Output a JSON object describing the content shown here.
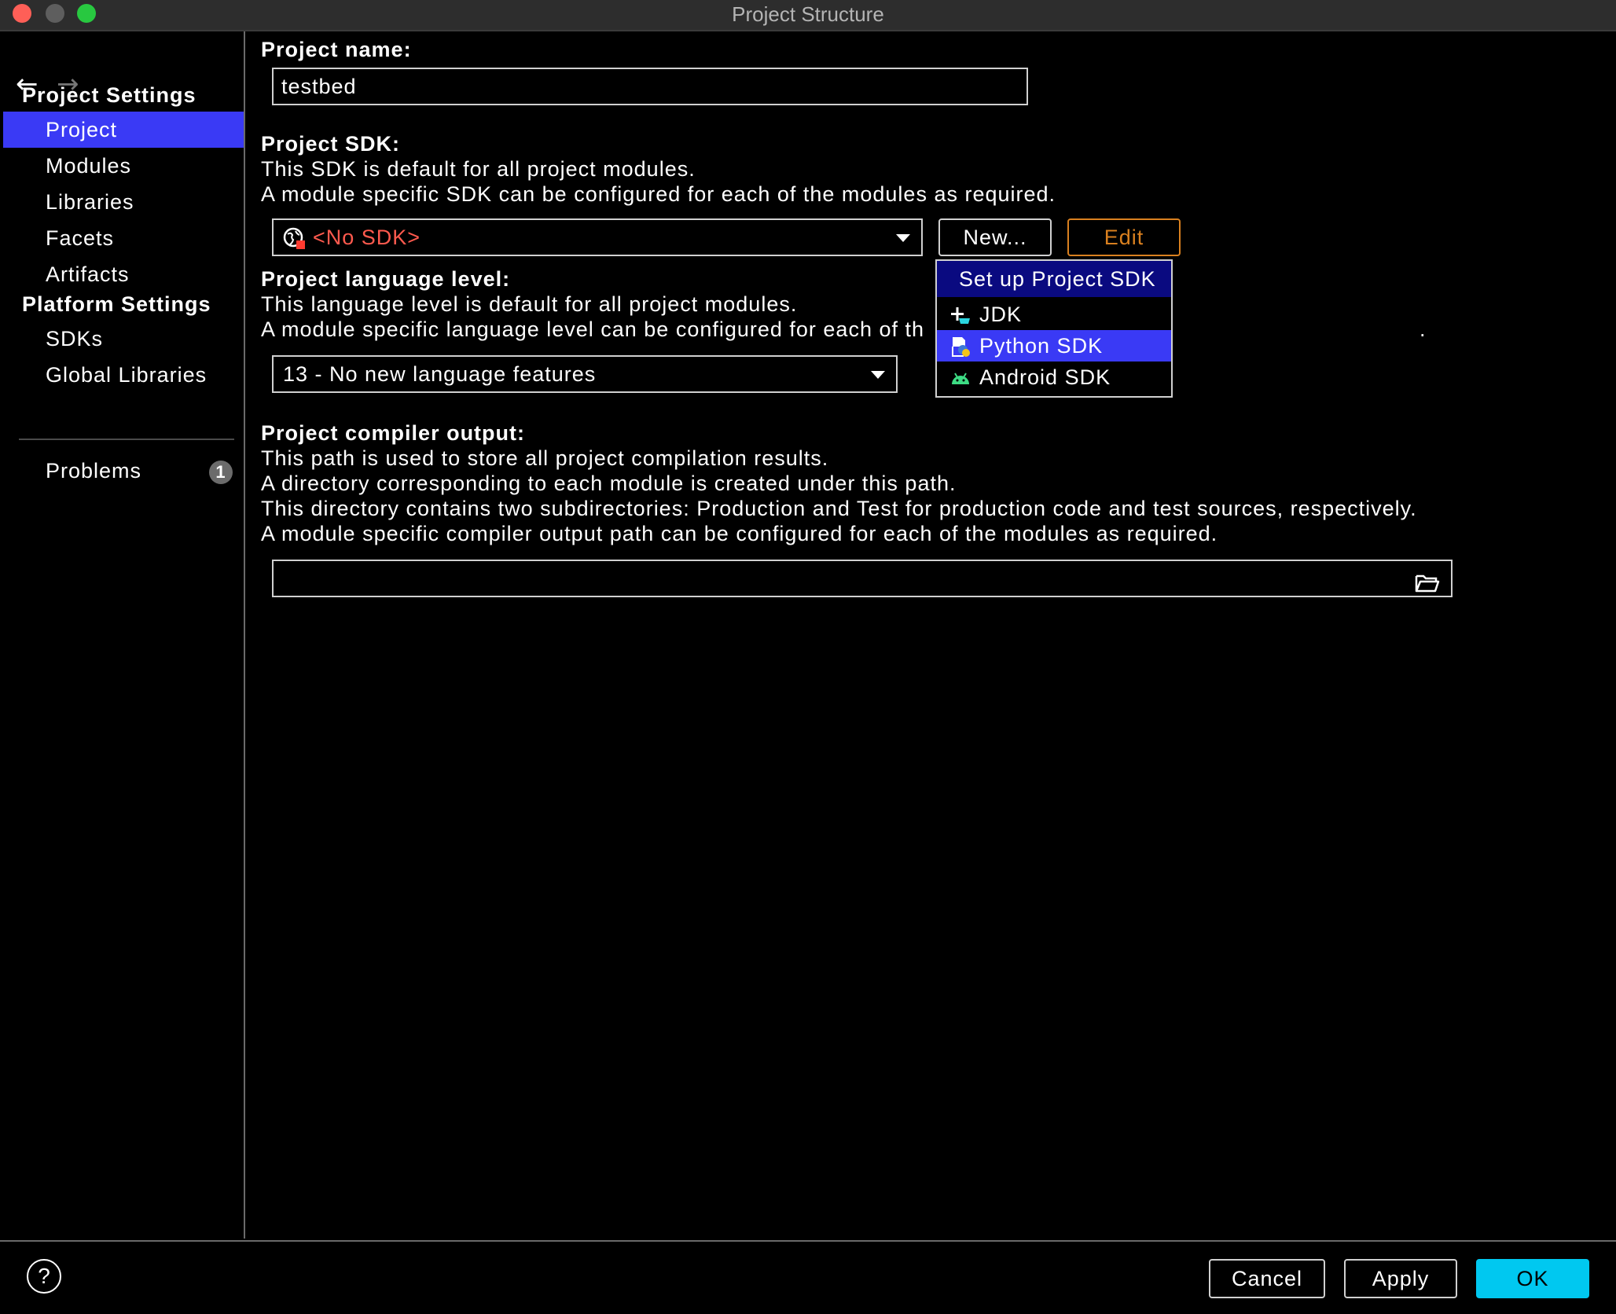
{
  "window": {
    "title": "Project Structure"
  },
  "nav": {
    "back_icon": "arrow-left-icon",
    "forward_icon": "arrow-right-icon"
  },
  "sidebar": {
    "project_settings_header": "Project Settings",
    "project_items": [
      {
        "label": "Project",
        "selected": true
      },
      {
        "label": "Modules",
        "selected": false
      },
      {
        "label": "Libraries",
        "selected": false
      },
      {
        "label": "Facets",
        "selected": false
      },
      {
        "label": "Artifacts",
        "selected": false
      }
    ],
    "platform_settings_header": "Platform Settings",
    "platform_items": [
      {
        "label": "SDKs"
      },
      {
        "label": "Global Libraries"
      }
    ],
    "problems": {
      "label": "Problems",
      "count": "1"
    }
  },
  "main": {
    "project_name": {
      "label": "Project name:",
      "value": "testbed"
    },
    "project_sdk": {
      "label": "Project SDK:",
      "desc1": "This SDK is default for all project modules.",
      "desc2": "A module specific SDK can be configured for each of the modules as required.",
      "selected": "<No SDK>",
      "new_button": "New...",
      "edit_button": "Edit"
    },
    "language_level": {
      "label": "Project language level:",
      "desc1": "This language level is default for all project modules.",
      "desc2_visible": "A module specific language level can be configured for each of th",
      "desc2_tail": ".",
      "selected": "13 - No new language features"
    },
    "compiler_output": {
      "label": "Project compiler output:",
      "desc1": "This path is used to store all project compilation results.",
      "desc2": "A directory corresponding to each module is created under this path.",
      "desc3": "This directory contains two subdirectories: Production and Test for production code and test sources, respectively.",
      "desc4": "A module specific compiler output path can be configured for each of the modules as required.",
      "value": ""
    }
  },
  "popup": {
    "header": "Set up Project SDK",
    "items": [
      {
        "label": "JDK",
        "icon": "jdk-add-icon",
        "selected": false
      },
      {
        "label": "Python SDK",
        "icon": "python-icon",
        "selected": true
      },
      {
        "label": "Android SDK",
        "icon": "android-icon",
        "selected": false
      }
    ]
  },
  "footer": {
    "help_label": "?",
    "cancel": "Cancel",
    "apply": "Apply",
    "ok": "OK"
  },
  "colors": {
    "selection": "#3a3af5",
    "popup_header": "#0a0a80",
    "error_text": "#ff5a4e",
    "edit_button": "#d9801f",
    "ok_button": "#00c8f0"
  }
}
